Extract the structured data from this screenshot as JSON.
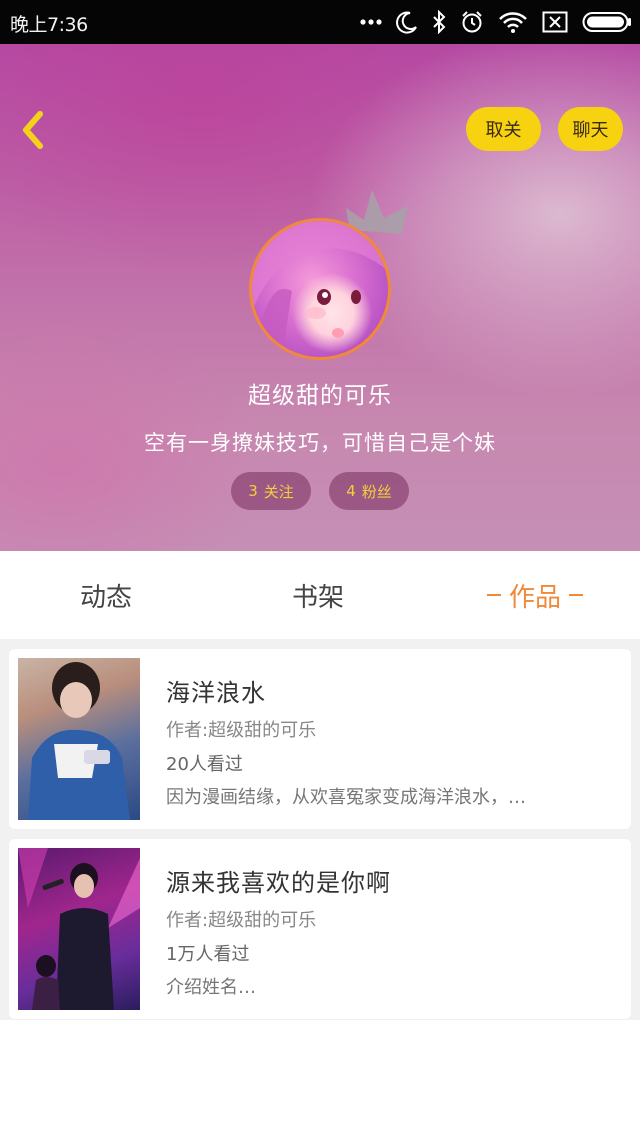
{
  "status_bar": {
    "time": "晚上7:36",
    "icons": [
      "more-dots-icon",
      "moon-icon",
      "bluetooth-icon",
      "alarm-icon",
      "wifi-icon",
      "no-sim-icon",
      "battery-icon"
    ]
  },
  "header": {
    "unfollow_label": "取关",
    "chat_label": "聊天",
    "nickname": "超级甜的可乐",
    "bio": "空有一身撩妹技巧，可惜自己是个妹",
    "following_count": "3",
    "following_label": "关注",
    "fans_count": "4",
    "fans_label": "粉丝"
  },
  "tabs": [
    {
      "label": "动态",
      "active": false
    },
    {
      "label": "书架",
      "active": false
    },
    {
      "label": "作品",
      "active": true
    }
  ],
  "works": [
    {
      "title": "海洋浪水",
      "author": "作者:超级甜的可乐",
      "views": "20人看过",
      "description": "因为漫画结缘，从欢喜冤家变成海洋浪水，…"
    },
    {
      "title": "源来我喜欢的是你啊",
      "author": "作者:超级甜的可乐",
      "views": "1万人看过",
      "description": "介绍姓名…"
    }
  ],
  "colors": {
    "accent_orange": "#f08a3a",
    "button_yellow": "#f7d211",
    "stat_text": "#f4cf3a"
  }
}
